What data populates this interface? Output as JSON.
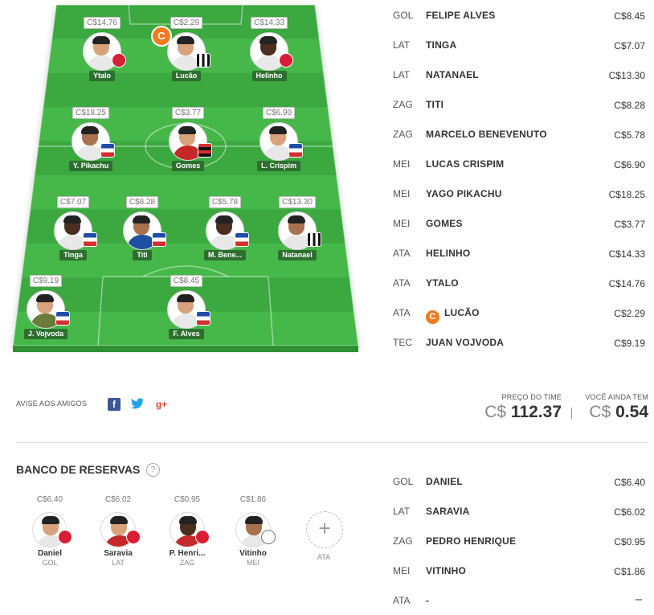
{
  "field": {
    "players": [
      {
        "id": "ytalo",
        "name": "Ytalo",
        "price": "C$14.76",
        "skin": "light",
        "shirt": "shirt-white",
        "badge": "rb"
      },
      {
        "id": "lucao",
        "name": "Lucão",
        "price": "C$2.29",
        "skin": "light",
        "shirt": "shirt-white",
        "badge": "bot",
        "captain": "C"
      },
      {
        "id": "helinho",
        "name": "Helinho",
        "price": "C$14.33",
        "skin": "dark",
        "shirt": "shirt-white",
        "badge": "rb"
      },
      {
        "id": "ypikachu",
        "name": "Y. Pikachu",
        "price": "C$18.25",
        "skin": "mid",
        "shirt": "shirt-white",
        "badge": "fort"
      },
      {
        "id": "gomes",
        "name": "Gomes",
        "price": "C$3.77",
        "skin": "light",
        "shirt": "shirt-red",
        "badge": "fla"
      },
      {
        "id": "lcrispim",
        "name": "L. Crispim",
        "price": "C$6.90",
        "skin": "light",
        "shirt": "shirt-white",
        "badge": "fort"
      },
      {
        "id": "tinga",
        "name": "Tinga",
        "price": "C$7.07",
        "skin": "dark",
        "shirt": "shirt-white",
        "badge": "fort"
      },
      {
        "id": "titi",
        "name": "Titi",
        "price": "C$8.28",
        "skin": "mid",
        "shirt": "shirt-blue",
        "badge": "fort"
      },
      {
        "id": "mbene",
        "name": "M. Bene...",
        "price": "C$5.78",
        "skin": "dark",
        "shirt": "shirt-white",
        "badge": "fort"
      },
      {
        "id": "natanael",
        "name": "Natanael",
        "price": "C$13.30",
        "skin": "mid",
        "shirt": "shirt-white",
        "badge": "bot"
      },
      {
        "id": "vojvoda",
        "name": "J. Vojvoda",
        "price": "C$9.19",
        "skin": "light",
        "shirt": "shirt-gk",
        "badge": "fort"
      },
      {
        "id": "falves",
        "name": "F. Alves",
        "price": "C$8.45",
        "skin": "light",
        "shirt": "shirt-white",
        "badge": "fort"
      }
    ]
  },
  "lineup": [
    {
      "pos": "GOL",
      "name": "FELIPE ALVES",
      "price": "C$8.45"
    },
    {
      "pos": "LAT",
      "name": "TINGA",
      "price": "C$7.07"
    },
    {
      "pos": "LAT",
      "name": "NATANAEL",
      "price": "C$13.30"
    },
    {
      "pos": "ZAG",
      "name": "TITI",
      "price": "C$8.28"
    },
    {
      "pos": "ZAG",
      "name": "MARCELO BENEVENUTO",
      "price": "C$5.78"
    },
    {
      "pos": "MEI",
      "name": "LUCAS CRISPIM",
      "price": "C$6.90"
    },
    {
      "pos": "MEI",
      "name": "YAGO PIKACHU",
      "price": "C$18.25"
    },
    {
      "pos": "MEI",
      "name": "GOMES",
      "price": "C$3.77"
    },
    {
      "pos": "ATA",
      "name": "HELINHO",
      "price": "C$14.33"
    },
    {
      "pos": "ATA",
      "name": "YTALO",
      "price": "C$14.76"
    },
    {
      "pos": "ATA",
      "name": "LUCÃO",
      "price": "C$2.29",
      "captain": "C"
    },
    {
      "pos": "TEC",
      "name": "JUAN VOJVODA",
      "price": "C$9.19"
    }
  ],
  "share": {
    "label": "AVISE AOS AMIGOS",
    "fb": "f",
    "tw": "🐦",
    "gp": "g+"
  },
  "totals": {
    "team_price_label": "PREÇO DO TIME",
    "team_price_currency": "C$",
    "team_price_value": "112.37",
    "remaining_label": "VOCÊ AINDA TEM",
    "remaining_currency": "C$",
    "remaining_value": "0.54"
  },
  "bench": {
    "title": "BANCO DE RESERVAS",
    "help": "?",
    "players": [
      {
        "name": "Daniel",
        "pos": "GOL",
        "price": "C$6.40",
        "skin": "light",
        "shirt": "shirt-white",
        "badge": "inter"
      },
      {
        "name": "Saravia",
        "pos": "LAT",
        "price": "C$6.02",
        "skin": "light",
        "shirt": "shirt-red",
        "badge": "inter"
      },
      {
        "name": "P. Henri...",
        "pos": "ZAG",
        "price": "C$0.95",
        "skin": "dark",
        "shirt": "shirt-red",
        "badge": "inter"
      },
      {
        "name": "Vitinho",
        "pos": "MEI",
        "price": "C$1.86",
        "skin": "mid",
        "shirt": "shirt-white",
        "badge": "cor"
      }
    ],
    "add_symbol": "+",
    "add_pos": "ATA",
    "list": [
      {
        "pos": "GOL",
        "name": "DANIEL",
        "price": "C$6.40"
      },
      {
        "pos": "LAT",
        "name": "SARAVIA",
        "price": "C$6.02"
      },
      {
        "pos": "ZAG",
        "name": "PEDRO HENRIQUE",
        "price": "C$0.95"
      },
      {
        "pos": "MEI",
        "name": "VITINHO",
        "price": "C$1.86"
      },
      {
        "pos": "ATA",
        "name": "-",
        "price": ""
      }
    ]
  },
  "colors": {
    "field_dark": "#3aa83f",
    "field_light": "#46b84a",
    "accent_orange": "#f07c1d",
    "name_tag": "#2e6f2f"
  }
}
